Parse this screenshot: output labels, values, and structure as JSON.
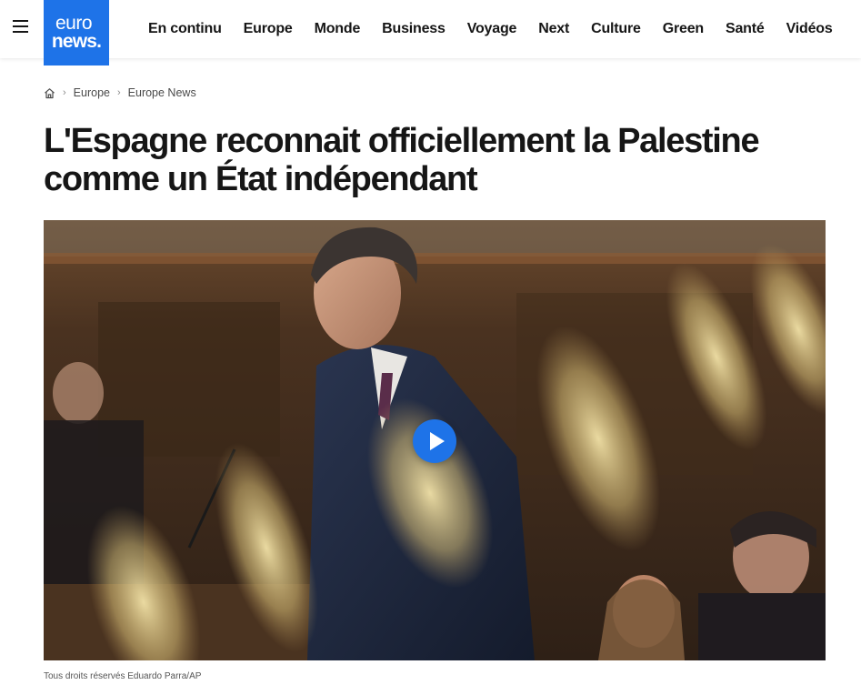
{
  "header": {
    "logo": {
      "line1": "euro",
      "line2": "news."
    },
    "nav": [
      "En continu",
      "Europe",
      "Monde",
      "Business",
      "Voyage",
      "Next",
      "Culture",
      "Green",
      "Santé",
      "Vidéos"
    ]
  },
  "breadcrumb": {
    "items": [
      "Europe",
      "Europe News"
    ]
  },
  "article": {
    "title": "L'Espagne reconnait officiellement la Palestine comme un État indépendant",
    "image_caption": "Tous droits réservés Eduardo Parra/AP"
  },
  "colors": {
    "brand": "#1e73e8",
    "text": "#161616"
  },
  "icons": {
    "menu": "hamburger-icon",
    "home": "home-icon",
    "separator": "chevron-right-icon",
    "play": "play-icon"
  }
}
